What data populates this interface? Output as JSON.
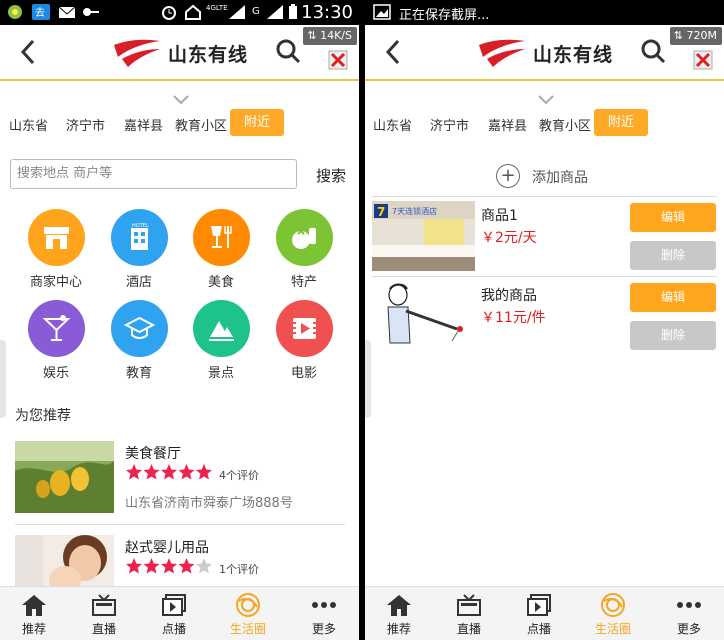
{
  "left": {
    "statusbar": {
      "time": "13:30",
      "net_label": "4GLTE"
    },
    "header": {
      "logo_text": "山东有线",
      "speed": "14K/S"
    },
    "regions": [
      "山东省",
      "济宁市",
      "嘉祥县",
      "教育小区"
    ],
    "region_active": "附近",
    "search": {
      "placeholder": "搜索地点 商户等",
      "button": "搜索"
    },
    "categories": [
      {
        "label": "商家中心",
        "icon": "shop-icon",
        "color": "#ffa41c"
      },
      {
        "label": "酒店",
        "icon": "hotel-icon",
        "color": "#2fa3ef"
      },
      {
        "label": "美食",
        "icon": "food-icon",
        "color": "#ff8a00"
      },
      {
        "label": "特产",
        "icon": "specialty-icon",
        "color": "#7cc433"
      },
      {
        "label": "娱乐",
        "icon": "cocktail-icon",
        "color": "#8a5bd6"
      },
      {
        "label": "教育",
        "icon": "graduation-cap-icon",
        "color": "#2fa3ef"
      },
      {
        "label": "景点",
        "icon": "scenery-icon",
        "color": "#1ec28b"
      },
      {
        "label": "电影",
        "icon": "film-icon",
        "color": "#f05050"
      }
    ],
    "recommend_title": "为您推荐",
    "recommendations": [
      {
        "name": "美食餐厅",
        "rating": 5,
        "reviews": "4个评价",
        "address": "山东省济南市舜泰广场888号"
      },
      {
        "name": "赵式婴儿用品",
        "rating": 4,
        "reviews": "1个评价",
        "address": ""
      }
    ]
  },
  "right": {
    "statusbar": {
      "save_text": "正在保存截屏..."
    },
    "header": {
      "logo_text": "山东有线",
      "speed": "720M"
    },
    "regions": [
      "山东省",
      "济宁市",
      "嘉祥县",
      "教育小区"
    ],
    "region_active": "附近",
    "add_label": "添加商品",
    "products": [
      {
        "name": "商品1",
        "price": "￥2元/天",
        "edit": "编辑",
        "delete": "删除"
      },
      {
        "name": "我的商品",
        "price": "￥11元/件",
        "edit": "编辑",
        "delete": "删除"
      }
    ]
  },
  "tabs": [
    {
      "label": "推荐",
      "icon": "home-icon"
    },
    {
      "label": "直播",
      "icon": "tv-icon"
    },
    {
      "label": "点播",
      "icon": "play-icon"
    },
    {
      "label": "生活圈",
      "icon": "life-circle-icon",
      "active": true
    },
    {
      "label": "更多",
      "icon": "more-icon"
    }
  ],
  "colors": {
    "accent": "#ffa928",
    "header_line": "#f3c33b",
    "price": "#e02020",
    "star": "#f0224c"
  }
}
